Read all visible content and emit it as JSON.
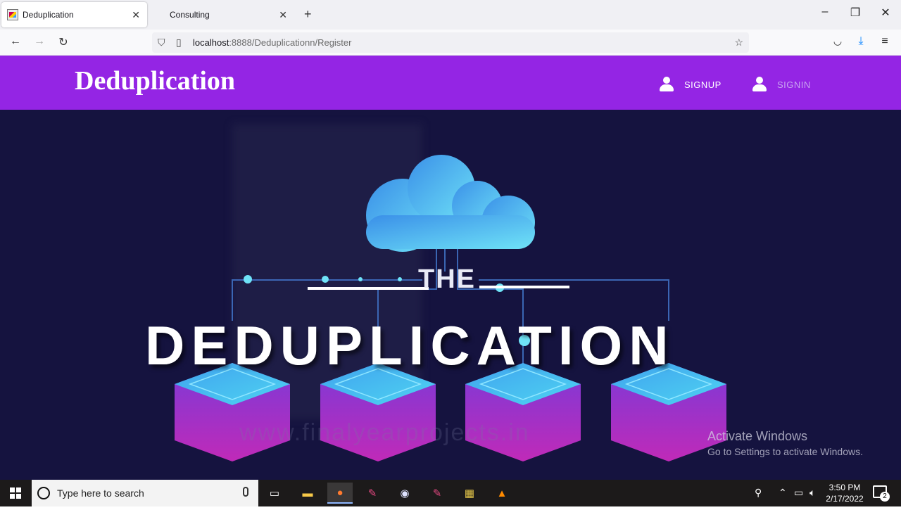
{
  "browser": {
    "tabs": [
      {
        "title": "Deduplication",
        "active": true
      },
      {
        "title": "Consulting",
        "active": false
      }
    ],
    "new_tab_icon": "plus-icon",
    "url_host": "localhost",
    "url_path": ":8888/Deduplicationn/Register",
    "window_controls": [
      "minimize",
      "restore",
      "close"
    ]
  },
  "site": {
    "brand": "Deduplication",
    "nav": [
      {
        "label": "SIGNUP",
        "icon": "user-icon",
        "color": "#ffffff"
      },
      {
        "label": "SIGNIN",
        "icon": "user-icon",
        "color": "#c9a5f0"
      }
    ],
    "header_color": "#9425e4"
  },
  "hero": {
    "pre_title": "THE",
    "title": "DEDUPLICATION",
    "watermark": "www.finalyearprojects.in",
    "background_color": "#15133f"
  },
  "os_overlay": {
    "activate_title": "Activate Windows",
    "activate_sub": "Go to Settings to activate Windows."
  },
  "taskbar": {
    "search_placeholder": "Type here to search",
    "time": "3:50 PM",
    "date": "2/17/2022",
    "notification_count": "2"
  }
}
